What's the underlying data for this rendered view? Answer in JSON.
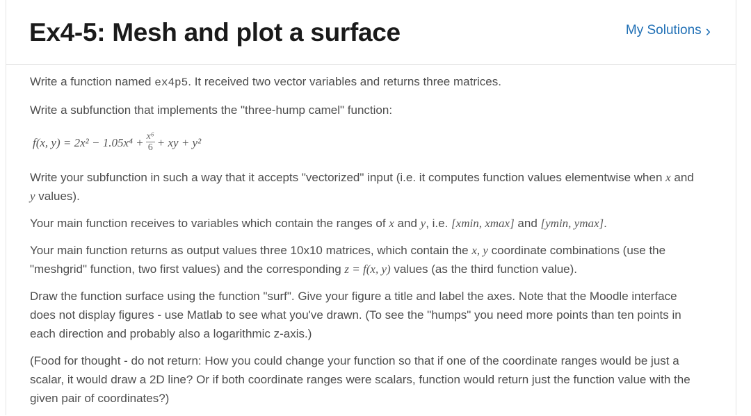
{
  "header": {
    "title": "Ex4-5: Mesh and plot a surface",
    "solutions_link": "My Solutions",
    "solutions_chevron": "›"
  },
  "content": {
    "p1_pre": "Write a function named ",
    "p1_code": "ex4p5",
    "p1_post": ". It received two vector variables and returns three matrices.",
    "p2": "Write a subfunction that implements the \"three-hump camel\" function:",
    "formula_lhs": "f(x, y) = 2x² − 1.05x⁴ +",
    "formula_num": "x⁶",
    "formula_den": "6",
    "formula_rhs": "+ xy + y²",
    "p3_pre": "Write your subfunction in such a way that it accepts \"vectorized\" input (i.e. it computes function values elementwise when ",
    "p3_x": "x",
    "p3_mid": " and ",
    "p3_y": "y",
    "p3_post": " values).",
    "p4_pre": "Your main function receives to variables which contain the ranges of ",
    "p4_x": "x",
    "p4_mid": " and ",
    "p4_y": "y",
    "p4_mid2": ", i.e. ",
    "p4_xrange": "[xmin, xmax]",
    "p4_and": " and ",
    "p4_yrange": "[ymin, ymax]",
    "p4_post": ".",
    "p5_pre": "Your main function returns as output values three 10x10 matrices, which contain the ",
    "p5_xy": "x, y",
    "p5_mid": " coordinate combinations (use the \"meshgrid\" function, two first values) and the corresponding ",
    "p5_z": "z = f(x, y)",
    "p5_post": " values (as the third function value).",
    "p6": "Draw the function surface using the function \"surf\". Give your figure a title and label the axes. Note that the Moodle interface does not display figures - use Matlab to see what  you've drawn. (To see the \"humps\" you need more points than ten points in each direction and probably also a logarithmic z-axis.)",
    "p7": "(Food for thought - do not return: How you could change your function so that if one of the coordinate ranges would be just a scalar, it would draw a 2D line? Or if both coordinate ranges were scalars, function would return just the function value with the given pair of coordinates?)"
  }
}
